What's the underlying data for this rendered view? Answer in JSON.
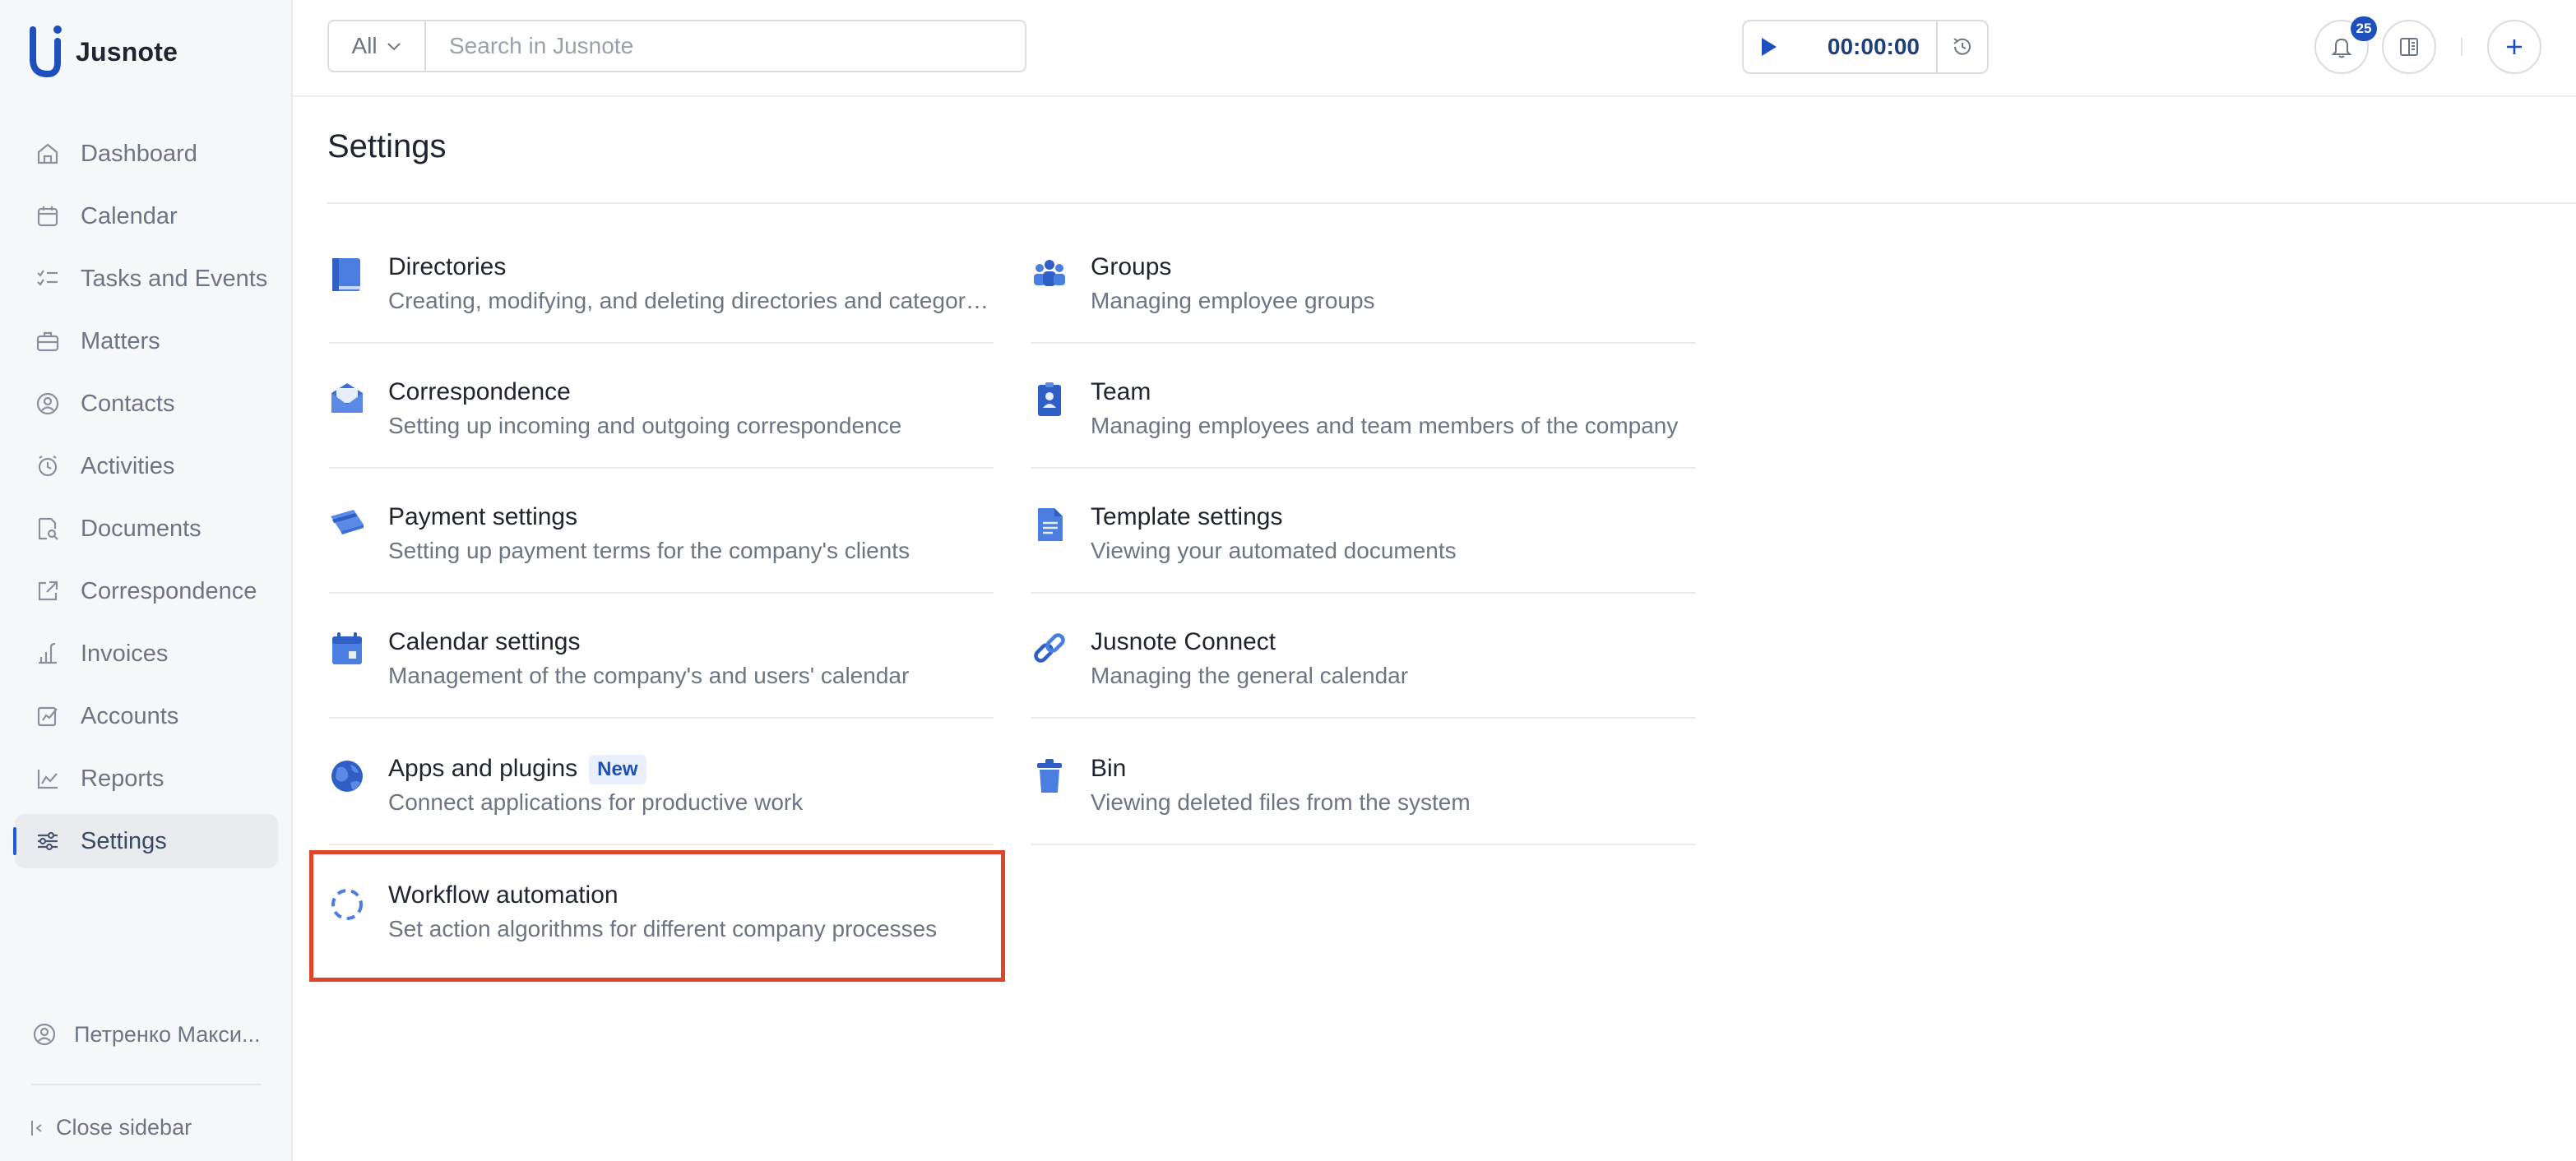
{
  "app": {
    "name": "Jusnote"
  },
  "sidebar": {
    "items": [
      {
        "label": "Dashboard",
        "icon": "home-icon"
      },
      {
        "label": "Calendar",
        "icon": "calendar-icon"
      },
      {
        "label": "Tasks and Events",
        "icon": "checklist-icon"
      },
      {
        "label": "Matters",
        "icon": "briefcase-icon"
      },
      {
        "label": "Contacts",
        "icon": "contacts-icon"
      },
      {
        "label": "Activities",
        "icon": "alarm-clock-icon"
      },
      {
        "label": "Documents",
        "icon": "document-search-icon"
      },
      {
        "label": "Correspondence",
        "icon": "external-link-icon"
      },
      {
        "label": "Invoices",
        "icon": "invoice-icon"
      },
      {
        "label": "Accounts",
        "icon": "accounts-icon"
      },
      {
        "label": "Reports",
        "icon": "chart-icon"
      },
      {
        "label": "Settings",
        "icon": "sliders-icon",
        "active": true
      }
    ],
    "user": "Петренко Макси...",
    "close_label": "Close sidebar"
  },
  "topbar": {
    "search_scope": "All",
    "search_placeholder": "Search in Jusnote",
    "timer": "00:00:00",
    "notification_count": "25"
  },
  "page": {
    "title": "Settings",
    "left_cards": [
      {
        "title": "Directories",
        "desc": "Creating, modifying, and deleting directories and categories",
        "icon": "book-icon"
      },
      {
        "title": "Correspondence",
        "desc": "Setting up incoming and outgoing correspondence",
        "icon": "envelope-icon"
      },
      {
        "title": "Payment settings",
        "desc": "Setting up payment terms for the company's clients",
        "icon": "credit-card-icon"
      },
      {
        "title": "Calendar settings",
        "desc": "Management of the company's and users' calendar",
        "icon": "calendar-icon"
      },
      {
        "title": "Apps and plugins",
        "badge": "New",
        "desc": "Connect applications for productive work",
        "icon": "globe-icon"
      },
      {
        "title": "Workflow automation",
        "desc": "Set action algorithms for different company processes",
        "icon": "loading-circle-icon"
      }
    ],
    "right_cards": [
      {
        "title": "Groups",
        "desc": "Managing employee groups",
        "icon": "people-icon"
      },
      {
        "title": "Team",
        "desc": "Managing employees and team members of the company",
        "icon": "id-badge-icon"
      },
      {
        "title": "Template settings",
        "desc": "Viewing your automated documents",
        "icon": "file-icon"
      },
      {
        "title": "Jusnote Connect",
        "desc": "Managing the general calendar",
        "icon": "chain-link-icon"
      },
      {
        "title": "Bin",
        "desc": "Viewing deleted files from the system",
        "icon": "trash-icon"
      }
    ]
  },
  "colors": {
    "accent": "#1e5bd8",
    "highlight": "#e0452a",
    "text": "#1f2430",
    "muted": "#6d7483"
  }
}
